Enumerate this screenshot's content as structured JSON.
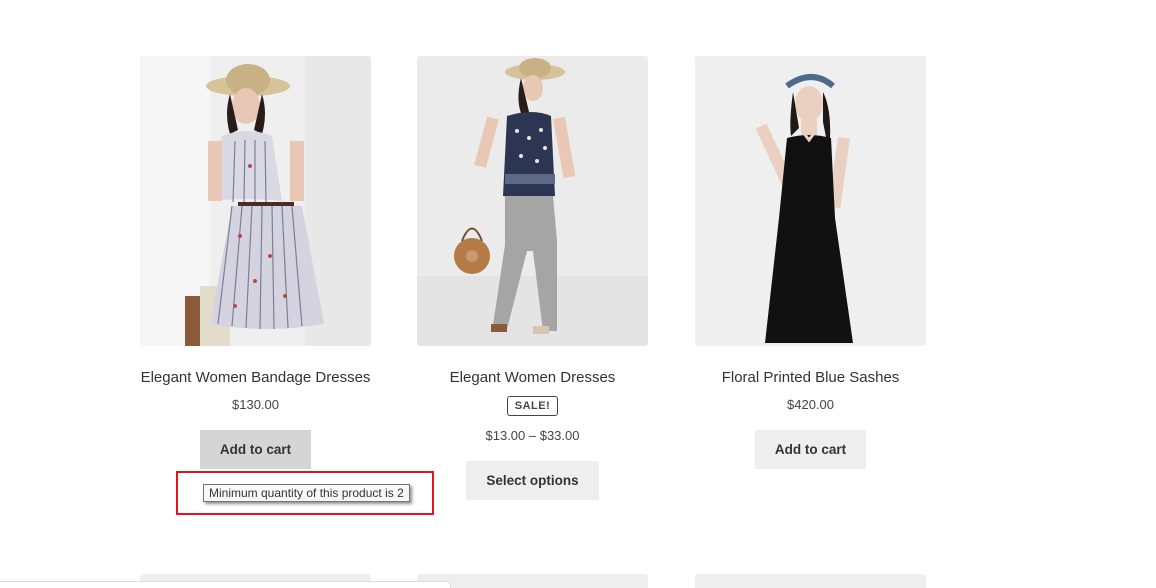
{
  "products": [
    {
      "title": "Elegant Women Bandage Dresses",
      "price": "$130.00",
      "button_label": "Add to cart"
    },
    {
      "title": "Elegant Women Dresses",
      "sale_badge": "SALE!",
      "price_range": "$13.00 – $33.00",
      "button_label": "Select options"
    },
    {
      "title": "Floral Printed Blue Sashes",
      "price": "$420.00",
      "button_label": "Add to cart"
    }
  ],
  "tooltip": {
    "text": "Minimum quantity of this product is 2"
  },
  "colors": {
    "button_bg": "#eeeeee",
    "button_hover_bg": "#d5d5d5",
    "highlight": "#e3141b",
    "text": "#43454b"
  }
}
